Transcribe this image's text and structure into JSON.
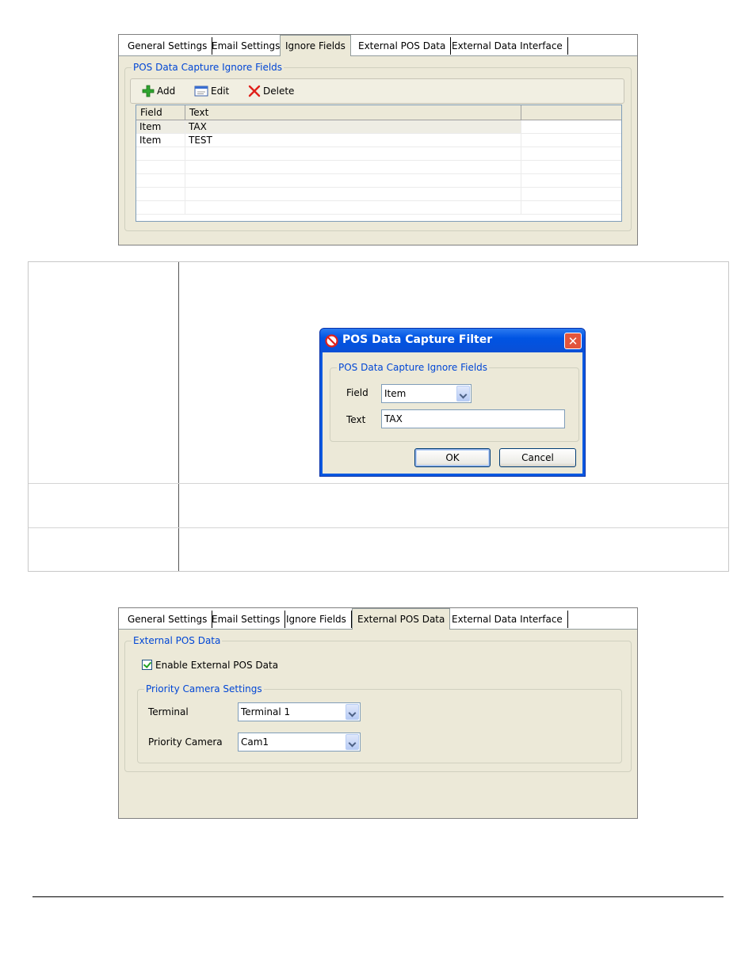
{
  "panel1": {
    "tabs": [
      "General Settings",
      "Email Settings",
      "Ignore Fields",
      "External POS Data",
      "External Data Interface"
    ],
    "active_tab": "Ignore Fields",
    "group_title": "POS Data Capture Ignore Fields",
    "toolbar": {
      "add_label": "Add",
      "edit_label": "Edit",
      "delete_label": "Delete"
    },
    "columns": [
      "Field",
      "Text",
      ""
    ],
    "rows": [
      {
        "field": "Item",
        "text": "TAX"
      },
      {
        "field": "Item",
        "text": "TEST"
      }
    ]
  },
  "dialog": {
    "title": "POS Data Capture Filter",
    "close_label": "✕",
    "group_title": "POS Data Capture Ignore Fields",
    "field_label": "Field",
    "field_value": "Item",
    "text_label": "Text",
    "text_value": "TAX",
    "ok_label": "OK",
    "cancel_label": "Cancel"
  },
  "panel2": {
    "tabs": [
      "General Settings",
      "Email Settings",
      "Ignore Fields",
      "External POS Data",
      "External Data Interface"
    ],
    "active_tab": "External POS Data",
    "group_title": "External POS Data",
    "enable_label": "Enable External POS Data",
    "enable_checked": true,
    "priority_group_title": "Priority Camera Settings",
    "terminal_label": "Terminal",
    "terminal_value": "Terminal 1",
    "priority_camera_label": "Priority Camera",
    "priority_camera_value": "Cam1"
  },
  "colors": {
    "accent_text": "#0046d5",
    "panel_bg": "#ece9d8",
    "titlebar": "#0054e3"
  }
}
